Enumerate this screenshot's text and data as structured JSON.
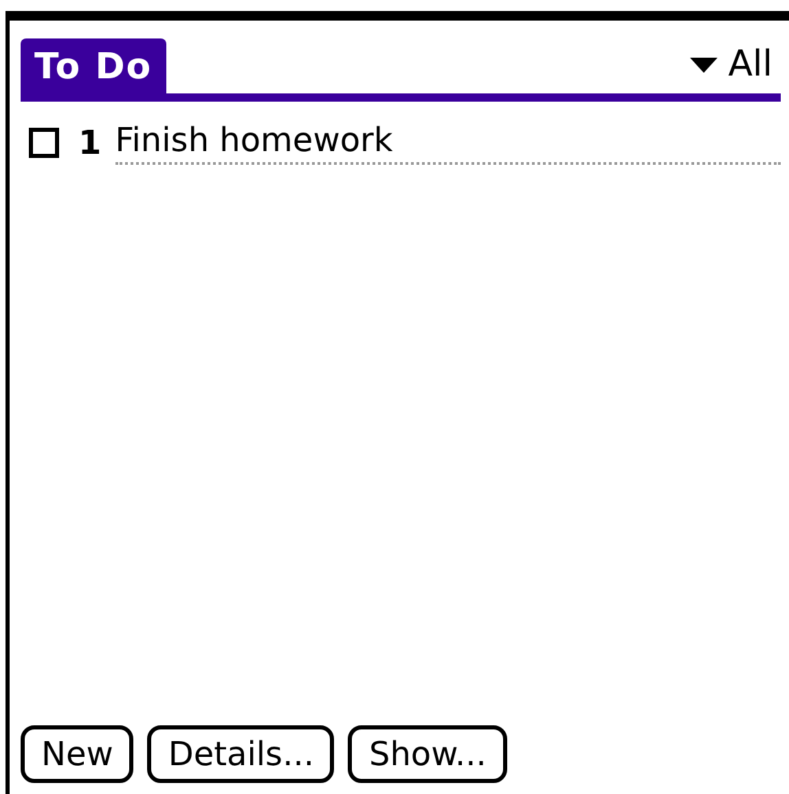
{
  "title": "To Do",
  "category": {
    "label": "All"
  },
  "tasks": [
    {
      "priority": "1",
      "text": "Finish homework",
      "checked": false
    }
  ],
  "buttons": [
    "New",
    "Details...",
    "Show..."
  ]
}
